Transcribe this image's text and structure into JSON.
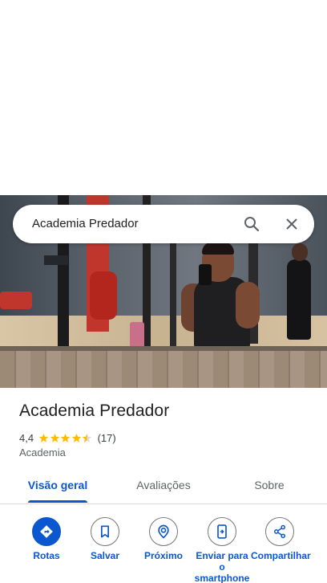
{
  "search": {
    "query": "Academia Predador"
  },
  "place": {
    "name": "Academia Predador",
    "rating": "4,4",
    "rating_value": 4.4,
    "reviews": "(17)",
    "category": "Academia"
  },
  "tabs": [
    {
      "label": "Visão geral",
      "active": true
    },
    {
      "label": "Avaliações",
      "active": false
    },
    {
      "label": "Sobre",
      "active": false
    }
  ],
  "actions": [
    {
      "label": "Rotas",
      "icon": "directions-icon"
    },
    {
      "label": "Salvar",
      "icon": "bookmark-icon"
    },
    {
      "label": "Próximo",
      "icon": "nearby-icon"
    },
    {
      "label": "Enviar para o smartphone",
      "icon": "send-to-phone-icon"
    },
    {
      "label": "Compartilhar",
      "icon": "share-icon"
    }
  ],
  "colors": {
    "accent": "#0b57d0",
    "star": "#fbbc04"
  }
}
